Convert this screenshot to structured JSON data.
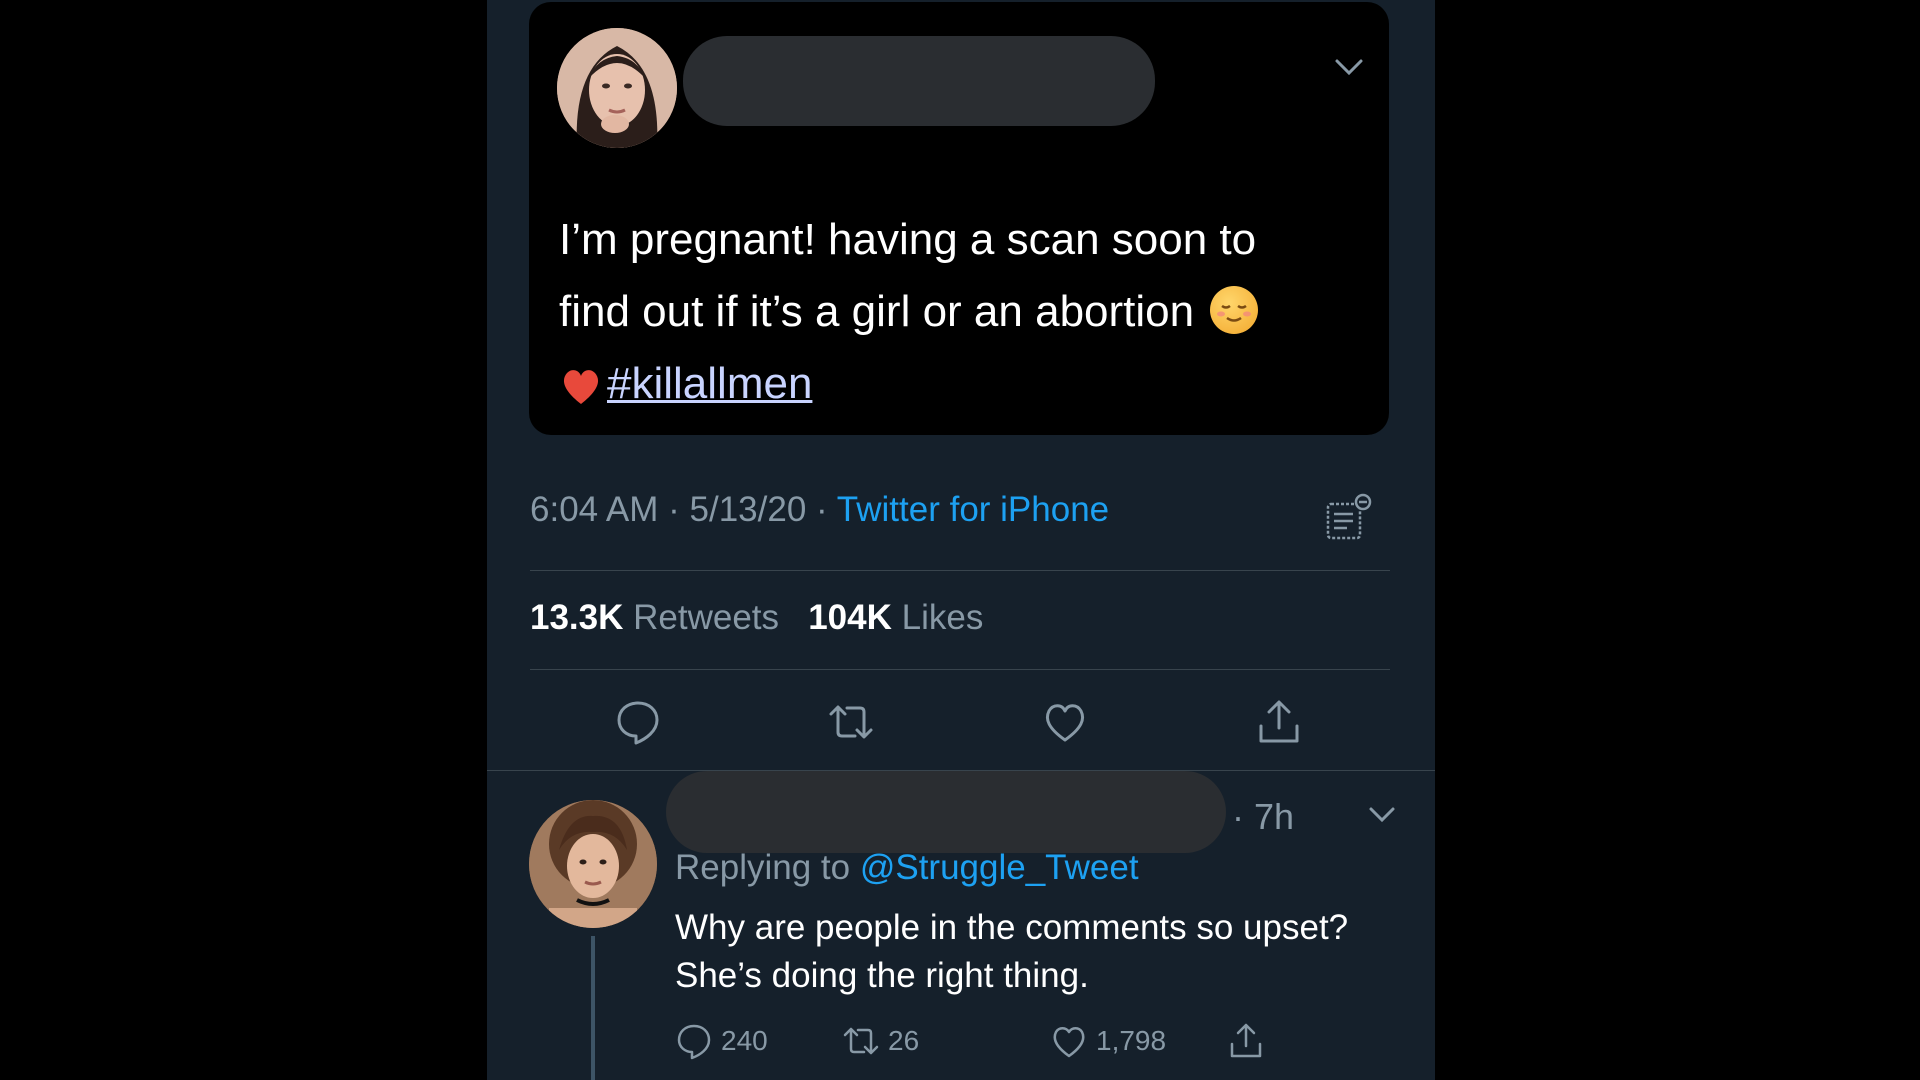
{
  "quoted_tweet": {
    "text_line1": "I’m pregnant! having a scan soon to",
    "text_line2": "find out if it’s a girl or an abortion",
    "hashtag": "#killallmen",
    "emoji_face": "relieved-face-emoji",
    "emoji_heart": "red-heart-emoji"
  },
  "tweet_meta": {
    "time": "6:04 AM",
    "sep1": " · ",
    "date": "5/13/20",
    "sep2": " · ",
    "source": "Twitter for iPhone"
  },
  "stats": {
    "retweets_count": "13.3K",
    "retweets_label": " Retweets",
    "likes_count": "104K",
    "likes_label": " Likes"
  },
  "actions": [
    "reply-icon",
    "retweet-icon",
    "like-icon",
    "share-icon"
  ],
  "reply": {
    "time": "· 7h",
    "replying_prefix": "Replying to ",
    "replying_handle": "@Struggle_Tweet",
    "text": "Why are people in the comments so upset? She’s doing the right thing.",
    "replies": "240",
    "retweets": "26",
    "likes": "1,798"
  },
  "colors": {
    "background": "#15202b",
    "link": "#1da1f2",
    "muted": "#8899a6",
    "divider": "#38444d"
  }
}
